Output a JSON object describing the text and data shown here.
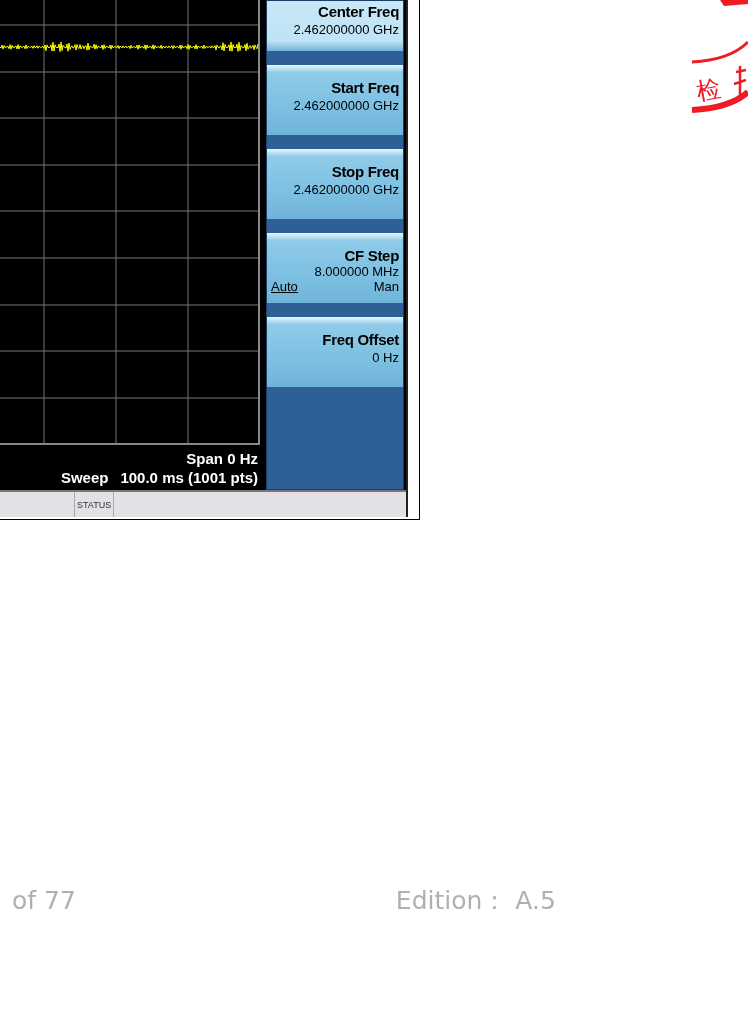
{
  "analyzer": {
    "span": "Span 0 Hz",
    "sweep_label": "Sweep",
    "sweep": "100.0 ms (1001 pts)",
    "softkeys": [
      {
        "kind": "value",
        "label": "Center Freq",
        "value": "2.462000000 GHz"
      },
      {
        "kind": "value",
        "label": "Start Freq",
        "value": "2.462000000 GHz"
      },
      {
        "kind": "value",
        "label": "Stop Freq",
        "value": "2.462000000 GHz"
      },
      {
        "kind": "toggle",
        "label": "CF Step",
        "value": "8.000000 MHz",
        "options": [
          {
            "label": "Auto",
            "selected": true
          },
          {
            "label": "Man",
            "selected": false
          }
        ]
      },
      {
        "kind": "value",
        "label": "Freq Offset",
        "value": "0 Hz"
      }
    ],
    "status_bar": {
      "fields": [
        "STATUS"
      ]
    }
  },
  "stamp": {
    "text": "检"
  },
  "footer": {
    "page": "of 77",
    "edition": "Edition： A.5"
  }
}
